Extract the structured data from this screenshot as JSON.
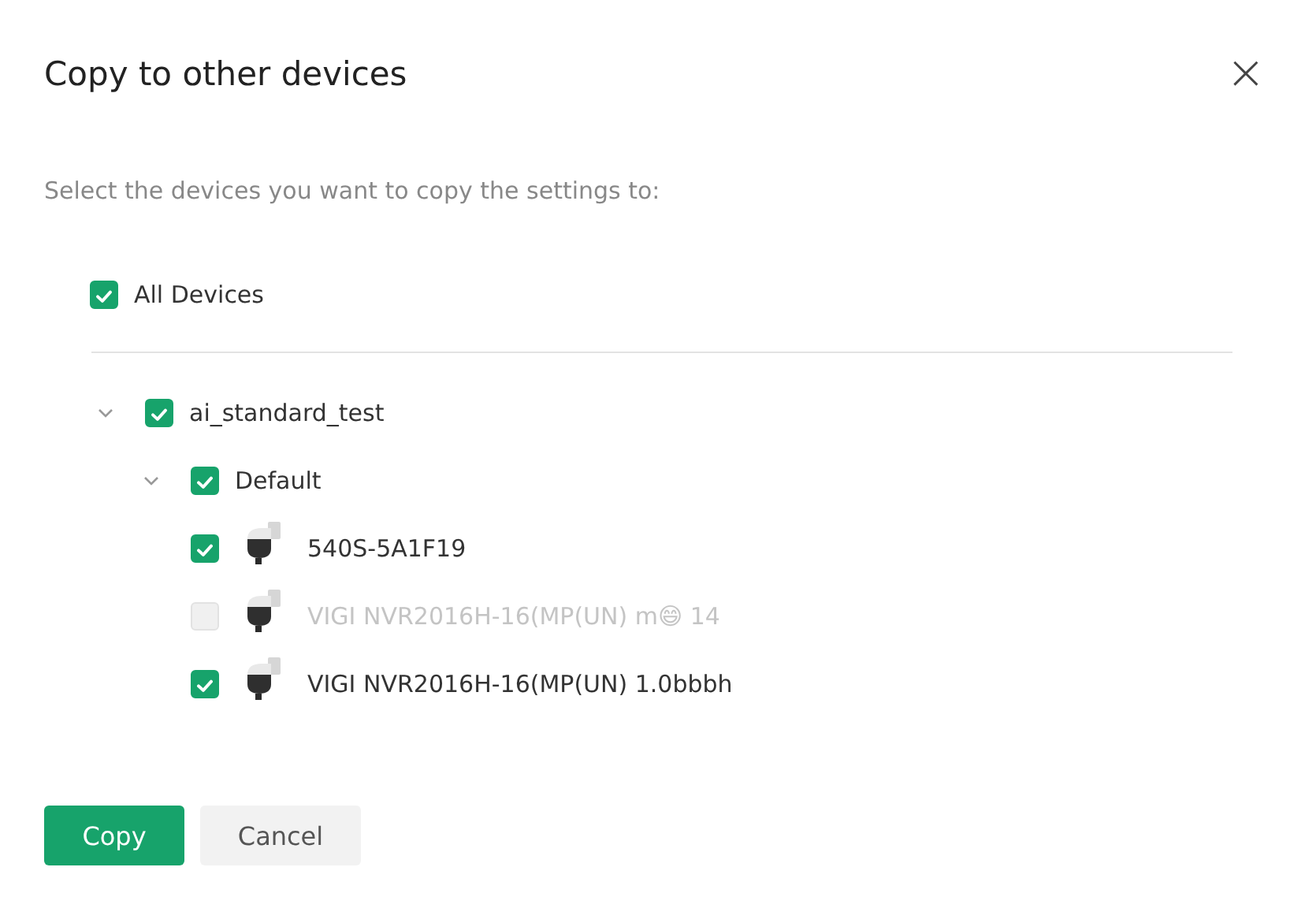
{
  "dialog": {
    "title": "Copy to other devices",
    "close": "×"
  },
  "instruction": "Select the devices you want to copy the settings to:",
  "all_devices": {
    "label": "All Devices",
    "checked": true
  },
  "tree": [
    {
      "label": "ai_standard_test",
      "checked": true,
      "expanded": true,
      "children": [
        {
          "label": "Default",
          "checked": true,
          "expanded": true,
          "children": [
            {
              "label": "540S-5A1F19",
              "kind": "device",
              "checked": true,
              "disabled": false
            },
            {
              "label": "VIGI NVR2016H-16(MP(UN) m😄 14",
              "kind": "device",
              "checked": false,
              "disabled": true
            },
            {
              "label": "VIGI NVR2016H-16(MP(UN) 1.0bbbh",
              "kind": "device",
              "checked": true,
              "disabled": false
            }
          ]
        }
      ]
    }
  ],
  "buttons": [
    {
      "label": "Copy",
      "kind": "primary"
    },
    {
      "label": "Cancel",
      "kind": "secondary"
    }
  ]
}
